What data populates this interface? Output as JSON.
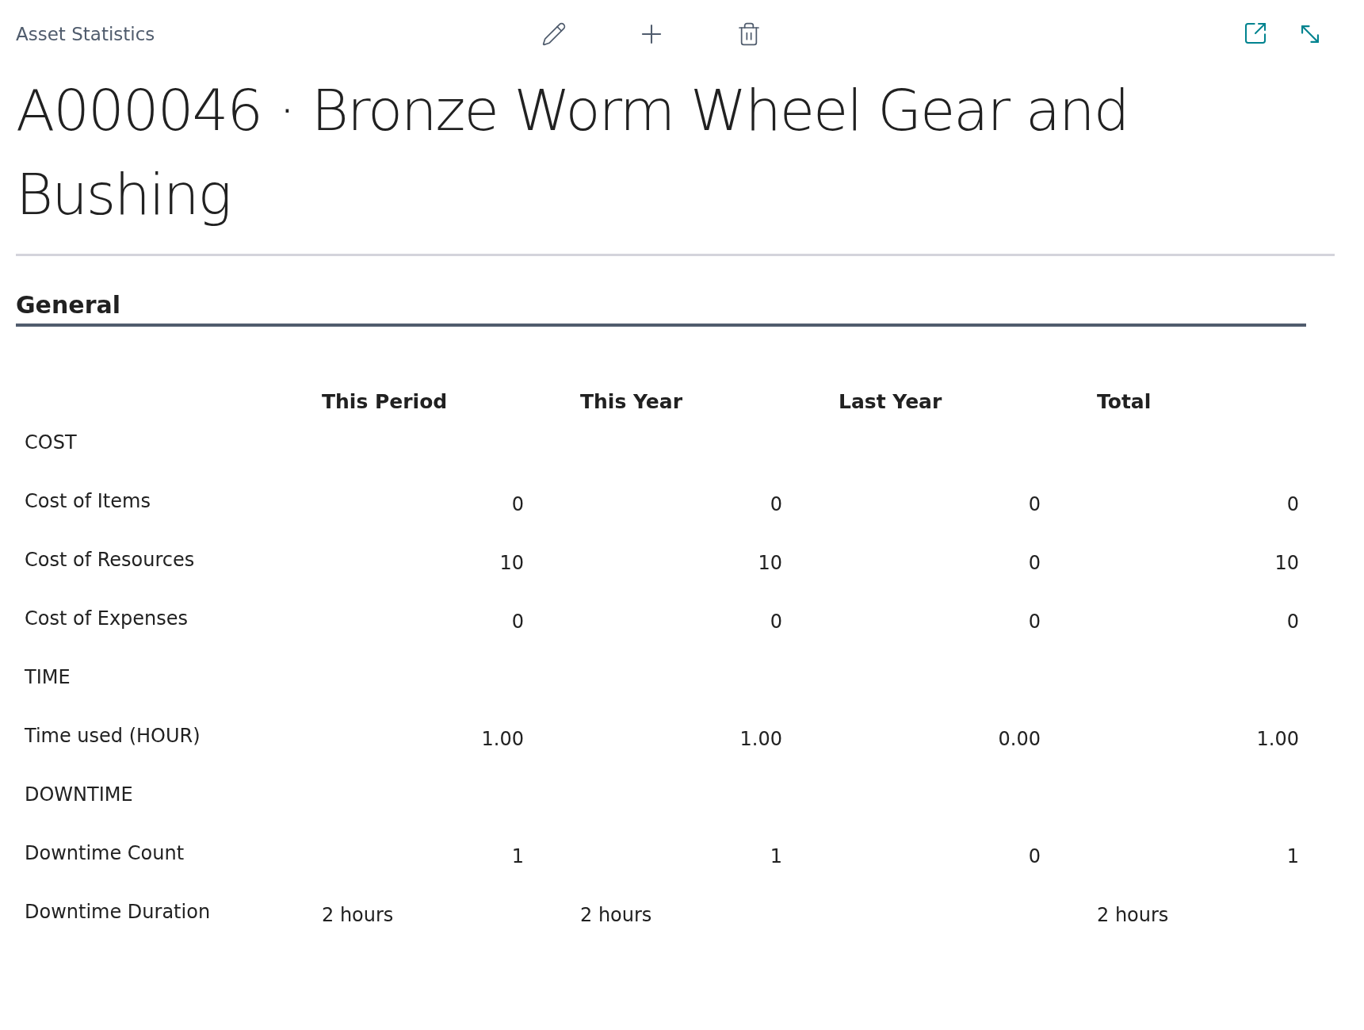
{
  "header": {
    "caption": "Asset Statistics"
  },
  "title": "A000046 · Bronze Worm Wheel Gear and Bushing",
  "section": {
    "title": "General"
  },
  "table": {
    "columns": [
      "This Period",
      "This Year",
      "Last Year",
      "Total"
    ],
    "rows": [
      {
        "kind": "section",
        "label": "COST"
      },
      {
        "kind": "number",
        "label": "Cost of Items",
        "values": {
          "column_1": "0",
          "column_2": "0",
          "column_3": "0",
          "column_4": "0"
        }
      },
      {
        "kind": "number",
        "label": "Cost of Resources",
        "values": {
          "column_1": "10",
          "column_2": "10",
          "column_3": "0",
          "column_4": "10"
        }
      },
      {
        "kind": "number",
        "label": "Cost of Expenses",
        "values": {
          "column_1": "0",
          "column_2": "0",
          "column_3": "0",
          "column_4": "0"
        }
      },
      {
        "kind": "section",
        "label": "TIME"
      },
      {
        "kind": "number",
        "label": "Time used (HOUR)",
        "values": {
          "column_1": "1.00",
          "column_2": "1.00",
          "column_3": "0.00",
          "column_4": "1.00"
        }
      },
      {
        "kind": "section",
        "label": "DOWNTIME"
      },
      {
        "kind": "number",
        "label": "Downtime Count",
        "values": {
          "column_1": "1",
          "column_2": "1",
          "column_3": "0",
          "column_4": "1"
        }
      },
      {
        "kind": "text",
        "label": "Downtime Duration",
        "values": {
          "column_1": "2 hours",
          "column_2": "2 hours",
          "column_4": "2 hours"
        }
      }
    ]
  }
}
